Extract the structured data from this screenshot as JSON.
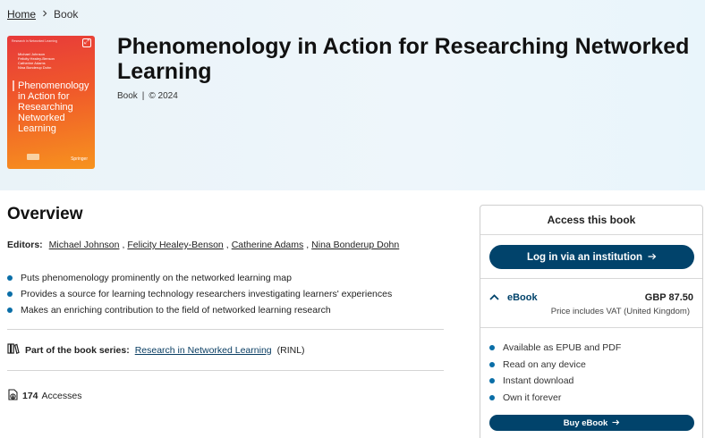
{
  "breadcrumb": {
    "home": "Home",
    "current": "Book"
  },
  "book": {
    "title": "Phenomenology in Action for Researching Networked Learning",
    "type": "Book",
    "separator": "|",
    "year": "© 2024",
    "cover": {
      "series": "Research in Networked Learning",
      "authors": [
        "Michael Johnson",
        "Felicity Healey-Benson",
        "Catherine Adams",
        "Nina Bonderup Dohn"
      ],
      "title": "Phenomenology in Action for Researching Networked Learning",
      "publisher": "Springer"
    }
  },
  "overview": {
    "heading": "Overview",
    "editors_label": "Editors:",
    "editors": [
      "Michael Johnson",
      "Felicity Healey-Benson",
      "Catherine Adams",
      "Nina Bonderup Dohn"
    ],
    "bullets": [
      "Puts phenomenology prominently on the networked learning map",
      "Provides a source for learning technology researchers investigating learners' experiences",
      "Makes an enriching contribution to the field of networked learning research"
    ],
    "series_label": "Part of the book series:",
    "series_name": "Research in Networked Learning",
    "series_abbr": "(RINL)",
    "accesses_count": "174",
    "accesses_label": "Accesses"
  },
  "access_panel": {
    "title": "Access this book",
    "institution_button": "Log in via an institution",
    "ebook_label": "eBook",
    "price": "GBP 87.50",
    "vat_note": "Price includes VAT (United Kingdom)",
    "features": [
      "Available as EPUB and PDF",
      "Read on any device",
      "Instant download",
      "Own it forever"
    ],
    "buy_button": "Buy eBook"
  },
  "colors": {
    "accent": "#01436b",
    "bullet": "#0a6ea7",
    "hero_bg": "#eaf3f8"
  },
  "icons": {
    "breadcrumb_sep": "chevron-right-icon",
    "series": "books-icon",
    "accesses": "download-icon",
    "arrow": "arrow-right-icon",
    "collapse": "chevron-up-icon",
    "expand": "expand-icon"
  }
}
